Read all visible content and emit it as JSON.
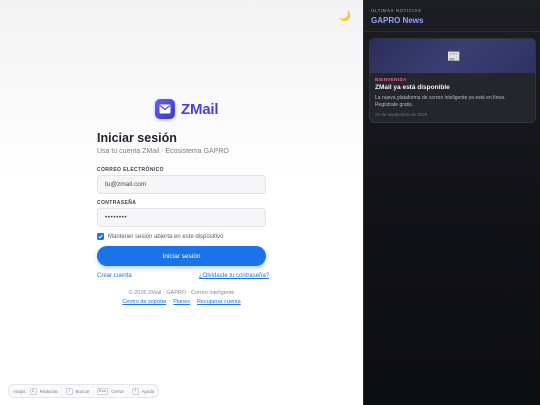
{
  "brand": {
    "name": "ZMail"
  },
  "theme_toggle": {
    "icon": "moon-icon",
    "glyph": "🌙"
  },
  "login": {
    "title": "Iniciar sesión",
    "subtitle": "Usa tu cuenta ZMail · Ecosistema GAPRO",
    "email_label": "CORREO ELECTRÓNICO",
    "email_value": "tu@zmail.com",
    "password_label": "CONTRASEÑA",
    "password_value": "••••••••",
    "remember_label": "Mantener sesión abierta en este dispositivo",
    "remember_checked": true,
    "submit_label": "Iniciar sesión",
    "create_account": "Crear cuenta",
    "forgot_password": "¿Olvidaste tu contraseña?"
  },
  "footer": {
    "copyright": "© 2026 ZMail · GAPRO · Correo inteligente",
    "link_support": "Centro de soporte",
    "link_plans": "Planes",
    "link_recover": "Recuperar cuenta"
  },
  "shortcuts": [
    {
      "label": "Atajos:"
    },
    {
      "key": "C",
      "label": "Redactar"
    },
    {
      "key": "/",
      "label": "Buscar"
    },
    {
      "key": "Esc",
      "label": "Cerrar"
    },
    {
      "key": "?",
      "label": "Ayuda"
    }
  ],
  "news": {
    "kicker": "ÚLTIMAS NOTICIAS",
    "title": "GAPRO News",
    "cards": [
      {
        "banner_icon": "newspaper-icon",
        "tag": "BIENVENIDA",
        "headline": "ZMail ya está disponible",
        "body": "La nueva plataforma de correo inteligente ya está en línea. Regístrate gratis.",
        "date": "22 de septiembre de 2026"
      }
    ]
  },
  "colors": {
    "accent": "#1a73e8",
    "brand": "#4b3fd8",
    "news_title": "#8ea8ff",
    "tag": "#e06aa0",
    "panel_dark": "#121318"
  }
}
